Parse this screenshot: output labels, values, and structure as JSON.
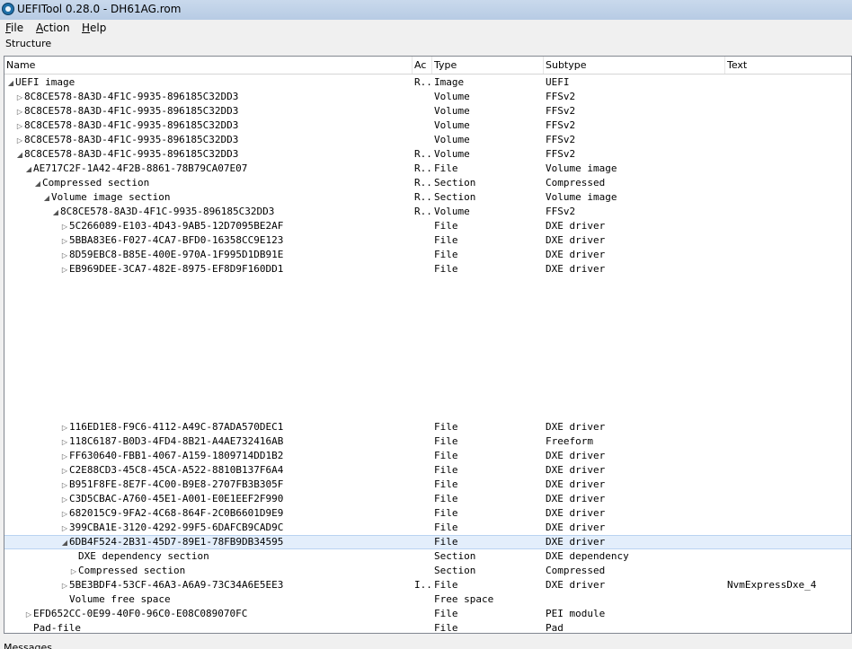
{
  "window": {
    "title": "UEFITool 0.28.0 - DH61AG.rom"
  },
  "menu": [
    {
      "underline": "F",
      "rest": "ile"
    },
    {
      "underline": "A",
      "rest": "ction"
    },
    {
      "underline": "H",
      "rest": "elp"
    }
  ],
  "structure_label": "Structure",
  "columns": {
    "name": "Name",
    "action": "Ac",
    "type": "Type",
    "subtype": "Subtype",
    "text": "Text"
  },
  "rows": [
    {
      "name": "UEFI image",
      "action": "R...",
      "type": "Image",
      "subtype": "UEFI",
      "text": "",
      "expander": "expanded"
    },
    {
      "name": "8C8CE578-8A3D-4F1C-9935-896185C32DD3",
      "action": "",
      "type": "Volume",
      "subtype": "FFSv2",
      "text": "",
      "expander": "collapsed"
    },
    {
      "name": "8C8CE578-8A3D-4F1C-9935-896185C32DD3",
      "action": "",
      "type": "Volume",
      "subtype": "FFSv2",
      "text": "",
      "expander": "collapsed"
    },
    {
      "name": "8C8CE578-8A3D-4F1C-9935-896185C32DD3",
      "action": "",
      "type": "Volume",
      "subtype": "FFSv2",
      "text": "",
      "expander": "collapsed"
    },
    {
      "name": "8C8CE578-8A3D-4F1C-9935-896185C32DD3",
      "action": "",
      "type": "Volume",
      "subtype": "FFSv2",
      "text": "",
      "expander": "collapsed"
    },
    {
      "name": "8C8CE578-8A3D-4F1C-9935-896185C32DD3",
      "action": "R...",
      "type": "Volume",
      "subtype": "FFSv2",
      "text": "",
      "expander": "expanded"
    },
    {
      "name": "AE717C2F-1A42-4F2B-8861-78B79CA07E07",
      "action": "R...",
      "type": "File",
      "subtype": "Volume image",
      "text": "",
      "expander": "expanded"
    },
    {
      "name": "Compressed section",
      "action": "R...",
      "type": "Section",
      "subtype": "Compressed",
      "text": "",
      "expander": "expanded"
    },
    {
      "name": "Volume image section",
      "action": "R...",
      "type": "Section",
      "subtype": "Volume image",
      "text": "",
      "expander": "expanded"
    },
    {
      "name": "8C8CE578-8A3D-4F1C-9935-896185C32DD3",
      "action": "R...",
      "type": "Volume",
      "subtype": "FFSv2",
      "text": "",
      "expander": "expanded"
    },
    {
      "name": "5C266089-E103-4D43-9AB5-12D7095BE2AF",
      "action": "",
      "type": "File",
      "subtype": "DXE driver",
      "text": "",
      "expander": "collapsed"
    },
    {
      "name": "5BBA83E6-F027-4CA7-BFD0-16358CC9E123",
      "action": "",
      "type": "File",
      "subtype": "DXE driver",
      "text": "",
      "expander": "collapsed"
    },
    {
      "name": "8D59EBC8-B85E-400E-970A-1F995D1DB91E",
      "action": "",
      "type": "File",
      "subtype": "DXE driver",
      "text": "",
      "expander": "collapsed"
    },
    {
      "name": "EB969DEE-3CA7-482E-8975-EF8D9F160DD1",
      "action": "",
      "type": "File",
      "subtype": "DXE driver",
      "text": "",
      "expander": "collapsed"
    },
    {
      "name": "116ED1E8-F9C6-4112-A49C-87ADA570DEC1",
      "action": "",
      "type": "File",
      "subtype": "DXE driver",
      "text": "",
      "expander": "collapsed"
    },
    {
      "name": "118C6187-B0D3-4FD4-8B21-A4AE732416AB",
      "action": "",
      "type": "File",
      "subtype": "Freeform",
      "text": "",
      "expander": "collapsed"
    },
    {
      "name": "FF630640-FBB1-4067-A159-1809714DD1B2",
      "action": "",
      "type": "File",
      "subtype": "DXE driver",
      "text": "",
      "expander": "collapsed"
    },
    {
      "name": "C2E88CD3-45C8-45CA-A522-8810B137F6A4",
      "action": "",
      "type": "File",
      "subtype": "DXE driver",
      "text": "",
      "expander": "collapsed"
    },
    {
      "name": "B951F8FE-8E7F-4C00-B9E8-2707FB3B305F",
      "action": "",
      "type": "File",
      "subtype": "DXE driver",
      "text": "",
      "expander": "collapsed"
    },
    {
      "name": "C3D5CBAC-A760-45E1-A001-E0E1EEF2F990",
      "action": "",
      "type": "File",
      "subtype": "DXE driver",
      "text": "",
      "expander": "collapsed"
    },
    {
      "name": "682015C9-9FA2-4C68-864F-2C0B6601D9E9",
      "action": "",
      "type": "File",
      "subtype": "DXE driver",
      "text": "",
      "expander": "collapsed"
    },
    {
      "name": "399CBA1E-3120-4292-99F5-6DAFCB9CAD9C",
      "action": "",
      "type": "File",
      "subtype": "DXE driver",
      "text": "",
      "expander": "collapsed"
    },
    {
      "name": "6DB4F524-2B31-45D7-89E1-78FB9DB34595",
      "action": "",
      "type": "File",
      "subtype": "DXE driver",
      "text": "",
      "expander": "expanded",
      "selected": true
    },
    {
      "name": "DXE dependency section",
      "action": "",
      "type": "Section",
      "subtype": "DXE dependency",
      "text": "",
      "expander": "none"
    },
    {
      "name": "Compressed section",
      "action": "",
      "type": "Section",
      "subtype": "Compressed",
      "text": "",
      "expander": "collapsed"
    },
    {
      "name": "5BE3BDF4-53CF-46A3-A6A9-73C34A6E5EE3",
      "action": "I...",
      "type": "File",
      "subtype": "DXE driver",
      "text": "NvmExpressDxe_4",
      "expander": "collapsed"
    },
    {
      "name": "Volume free space",
      "action": "",
      "type": "Free space",
      "subtype": "",
      "text": "",
      "expander": "none"
    },
    {
      "name": "EFD652CC-0E99-40F0-96C0-E08C089070FC",
      "action": "",
      "type": "File",
      "subtype": "PEI module",
      "text": "",
      "expander": "collapsed"
    },
    {
      "name": "Pad-file",
      "action": "",
      "type": "File",
      "subtype": "Pad",
      "text": "",
      "expander": "none"
    }
  ],
  "bottom_label": "Messages"
}
